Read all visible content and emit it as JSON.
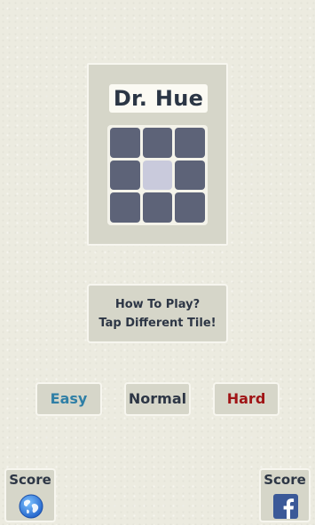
{
  "logo": {
    "title": "Dr. Hue",
    "grid": {
      "rows": 3,
      "cols": 3,
      "base_color": "#5d6378",
      "odd_color": "#c9cadc",
      "odd_index": 4
    }
  },
  "instructions": {
    "line1": "How To Play?",
    "line2": "Tap Different Tile!"
  },
  "difficulty": {
    "easy": {
      "label": "Easy",
      "color": "#2f7fa6"
    },
    "normal": {
      "label": "Normal",
      "color": "#2d3645"
    },
    "hard": {
      "label": "Hard",
      "color": "#a01416"
    }
  },
  "score_buttons": {
    "global": {
      "label": "Score",
      "icon": "globe-icon"
    },
    "facebook": {
      "label": "Score",
      "icon": "facebook-icon"
    }
  }
}
